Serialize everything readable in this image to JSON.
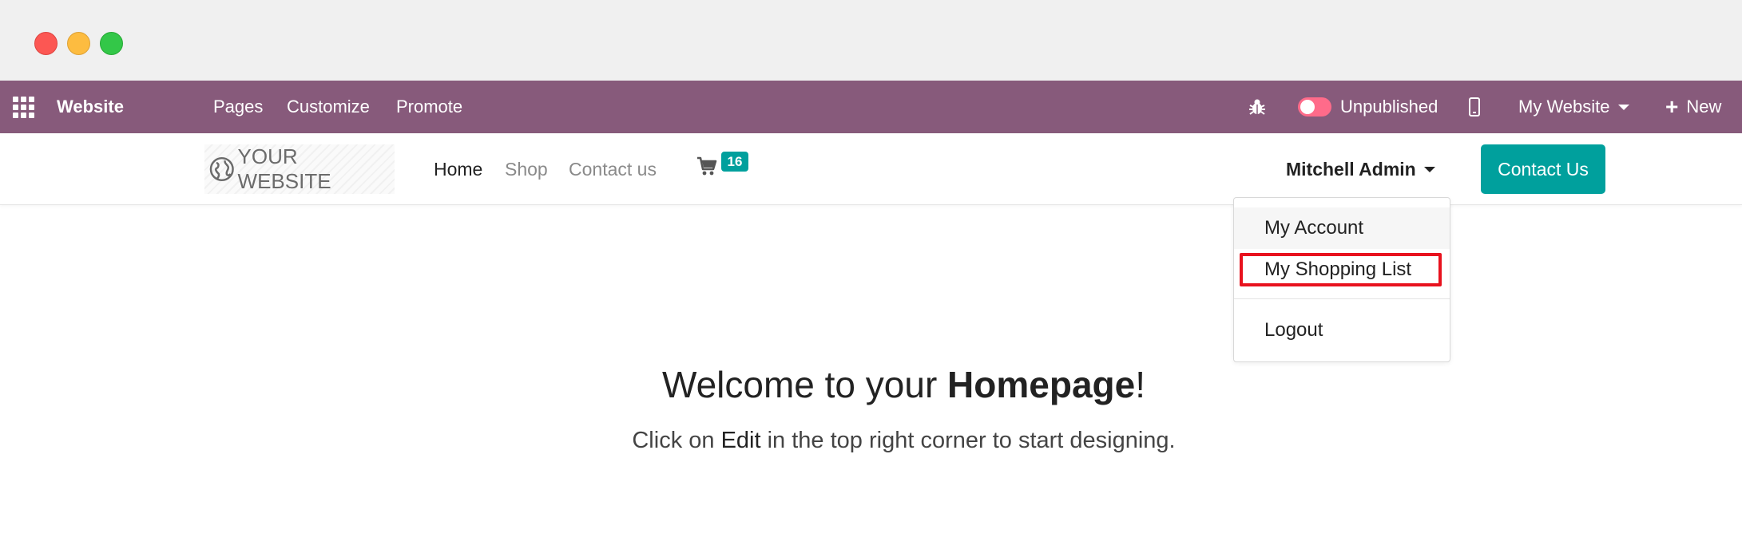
{
  "window": {
    "controls": [
      "close",
      "minimize",
      "maximize"
    ]
  },
  "topbar": {
    "app_name": "Website",
    "menu": [
      "Pages",
      "Customize",
      "Promote"
    ],
    "publish_status": "Unpublished",
    "website_selector": "My Website",
    "new_label": "New",
    "bar_color": "#875a7b",
    "icons": [
      "apps-grid-icon",
      "bug-icon",
      "mobile-icon",
      "plus-icon"
    ]
  },
  "site": {
    "logo_text": "YOUR WEBSITE",
    "nav": [
      "Home",
      "Shop",
      "Contact us"
    ],
    "cart_count": "16",
    "user_name": "Mitchell Admin",
    "contact_button": "Contact Us",
    "accent_color": "#00a09d"
  },
  "user_menu": {
    "items": [
      "My Account",
      "My Shopping List",
      "Logout"
    ],
    "highlighted_item": "My Shopping List"
  },
  "content": {
    "welcome_prefix": "Welcome to your ",
    "welcome_bold": "Homepage",
    "welcome_suffix": "!",
    "sub_prefix": "Click on ",
    "sub_bold": "Edit",
    "sub_suffix": " in the top right corner to start designing."
  }
}
